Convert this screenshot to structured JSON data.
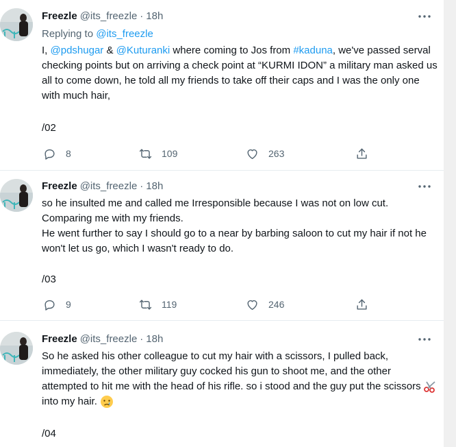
{
  "tweets": [
    {
      "name": "Freezle",
      "handle": "@its_freezle",
      "separator": "·",
      "time": "18h",
      "replying_prefix": "Replying to",
      "replying_handle": "@its_freezle",
      "text_prefix": "I, ",
      "mention1": "@pdshugar",
      "text_amp": " & ",
      "mention2": "@Kuturanki",
      "text_mid": " where coming to Jos from ",
      "hashtag": "#kaduna",
      "text_rest": ", we've passed serval checking points but on arriving a check point at “KURMI IDON” a military man asked us all to come down, he told all my friends to take off their caps and I was the only one with much hair,",
      "counter": "/02",
      "replies": "8",
      "retweets": "109",
      "likes": "263"
    },
    {
      "name": "Freezle",
      "handle": "@its_freezle",
      "separator": "·",
      "time": "18h",
      "line1": "so he insulted me and called me Irresponsible because I was not on low cut.",
      "line2": "Comparing me with my friends.",
      "line3": "He went further to say I should go to a near by barbing saloon to cut my hair if not he won't let us go, which I wasn't ready to do.",
      "counter": "/03",
      "replies": "9",
      "retweets": "119",
      "likes": "246"
    },
    {
      "name": "Freezle",
      "handle": "@its_freezle",
      "separator": "·",
      "time": "18h",
      "text": "So he asked his other colleague to cut my hair with a scissors, I pulled back, immediately, the other military guy cocked his gun to shoot me, and the other attempted to hit me with the head of his rifle. so i stood and the guy put the scissors",
      "text_after": " into my hair. ",
      "counter": "/04"
    }
  ],
  "icons": {
    "more": "more-dots-icon",
    "reply": "reply-bubble-icon",
    "retweet": "retweet-icon",
    "like": "heart-icon",
    "share": "share-upload-icon",
    "scissors": "scissors-emoji",
    "crying": "crying-face-emoji"
  },
  "colors": {
    "text": "#0f1419",
    "secondary": "#536471",
    "link": "#1d9bf0",
    "divider": "#e6ecf0"
  }
}
